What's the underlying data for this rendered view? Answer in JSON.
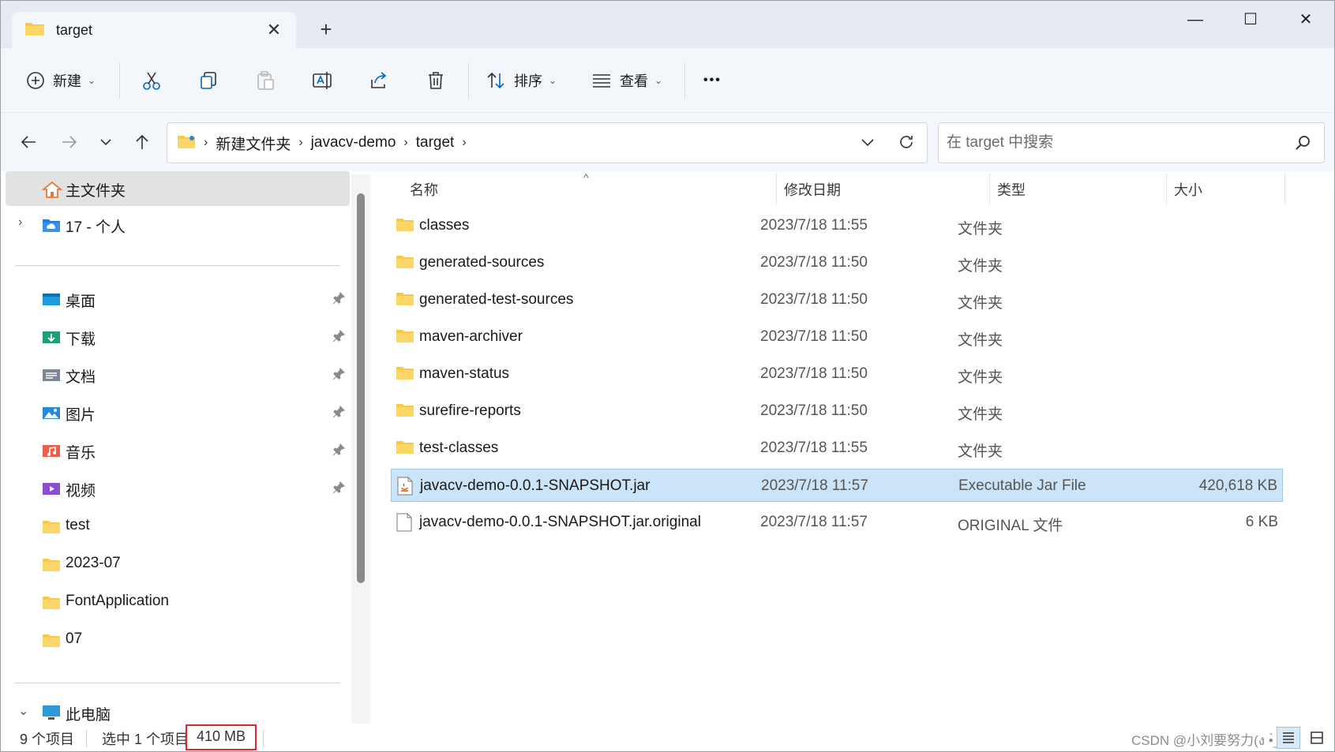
{
  "window": {
    "tab_title": "target",
    "new_tab_symbol": "+",
    "close_tab_symbol": "✕",
    "minimize_symbol": "—",
    "maximize_symbol": "☐",
    "close_symbol": "✕"
  },
  "toolbar": {
    "new_label": "新建",
    "sort_label": "排序",
    "view_label": "查看",
    "more_symbol": "•••",
    "icons": [
      "plus-circle-icon",
      "cut-icon",
      "copy-icon",
      "paste-icon",
      "rename-icon",
      "share-icon",
      "delete-icon",
      "sort-icon",
      "view-icon",
      "more-icon"
    ]
  },
  "address": {
    "crumbs": [
      "新建文件夹",
      "javacv-demo",
      "target"
    ],
    "sep": "›",
    "search_placeholder": "在 target 中搜索"
  },
  "sidebar": {
    "home_label": "主文件夹",
    "onedrive_label": "17 - 个人",
    "quick_access": [
      {
        "label": "桌面",
        "icon": "desktop-icon"
      },
      {
        "label": "下载",
        "icon": "download-icon"
      },
      {
        "label": "文档",
        "icon": "document-icon"
      },
      {
        "label": "图片",
        "icon": "pictures-icon"
      },
      {
        "label": "音乐",
        "icon": "music-icon"
      },
      {
        "label": "视频",
        "icon": "video-icon"
      },
      {
        "label": "test",
        "icon": "folder-icon"
      },
      {
        "label": "2023-07",
        "icon": "folder-icon"
      },
      {
        "label": "FontApplication",
        "icon": "folder-icon"
      },
      {
        "label": "07",
        "icon": "folder-icon"
      }
    ],
    "this_pc_label": "此电脑"
  },
  "columns": {
    "name": "名称",
    "date": "修改日期",
    "type": "类型",
    "size": "大小",
    "sort_caret": "^"
  },
  "files": [
    {
      "name": "classes",
      "date": "2023/7/18 11:55",
      "type": "文件夹",
      "size": ""
    },
    {
      "name": "generated-sources",
      "date": "2023/7/18 11:50",
      "type": "文件夹",
      "size": ""
    },
    {
      "name": "generated-test-sources",
      "date": "2023/7/18 11:50",
      "type": "文件夹",
      "size": ""
    },
    {
      "name": "maven-archiver",
      "date": "2023/7/18 11:50",
      "type": "文件夹",
      "size": ""
    },
    {
      "name": "maven-status",
      "date": "2023/7/18 11:50",
      "type": "文件夹",
      "size": ""
    },
    {
      "name": "surefire-reports",
      "date": "2023/7/18 11:50",
      "type": "文件夹",
      "size": ""
    },
    {
      "name": "test-classes",
      "date": "2023/7/18 11:55",
      "type": "文件夹",
      "size": ""
    },
    {
      "name": "javacv-demo-0.0.1-SNAPSHOT.jar",
      "date": "2023/7/18 11:57",
      "type": "Executable Jar File",
      "size": "420,618 KB"
    },
    {
      "name": "javacv-demo-0.0.1-SNAPSHOT.jar.original",
      "date": "2023/7/18 11:57",
      "type": "ORIGINAL 文件",
      "size": "6 KB"
    }
  ],
  "status": {
    "item_count": "9 个项目",
    "selected": "选中 1 个项目",
    "selected_size": "410 MB",
    "watermark": "CSDN @小刘要努力(ง •̀_•́)ง"
  },
  "colors": {
    "accent": "#0067c0",
    "selection_bg": "#cce4f7",
    "highlight_box": "#e0262a",
    "folder": "#f8c847"
  }
}
